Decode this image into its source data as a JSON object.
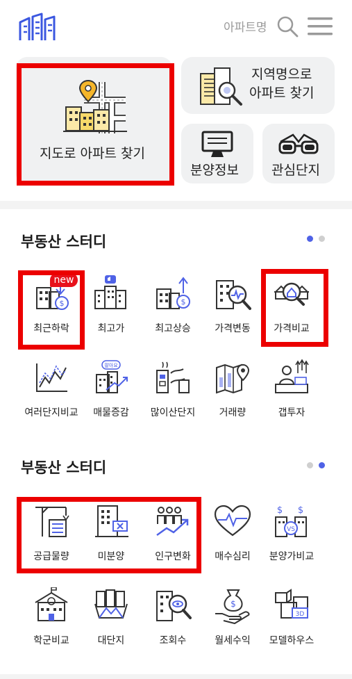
{
  "header": {
    "search_label": "아파트명",
    "logo": "apartment-logo",
    "icons": [
      "search-icon",
      "hamburger-menu-icon"
    ]
  },
  "quick": {
    "map_label": "지도로 아파트 찾기",
    "region_label": "지역명으로\n아파트 찾기",
    "sale_label": "분양정보",
    "fav_label": "관심단지"
  },
  "section1": {
    "title": "부동산 스터디",
    "items": [
      {
        "label": "최근하락",
        "badge": "new",
        "icon": "price-drop-icon"
      },
      {
        "label": "최고가",
        "icon": "top-price-icon"
      },
      {
        "label": "최고상승",
        "icon": "top-rise-icon"
      },
      {
        "label": "가격변동",
        "icon": "price-change-icon"
      },
      {
        "label": "가격비교",
        "icon": "price-compare-icon"
      },
      {
        "label": "여러단지비교",
        "icon": "multi-compare-icon"
      },
      {
        "label": "매물증감",
        "icon": "listing-change-icon"
      },
      {
        "label": "많이산단지",
        "icon": "most-bought-icon"
      },
      {
        "label": "거래량",
        "icon": "trade-volume-icon"
      },
      {
        "label": "갭투자",
        "icon": "gap-invest-icon"
      }
    ]
  },
  "section2": {
    "title": "부동산 스터디",
    "items": [
      {
        "label": "공급물량",
        "icon": "supply-icon"
      },
      {
        "label": "미분양",
        "icon": "unsold-icon"
      },
      {
        "label": "인구변화",
        "icon": "population-icon"
      },
      {
        "label": "매수심리",
        "icon": "buyer-sentiment-icon"
      },
      {
        "label": "분양가비교",
        "icon": "sale-price-compare-icon"
      },
      {
        "label": "학군비교",
        "icon": "school-district-icon"
      },
      {
        "label": "대단지",
        "icon": "large-complex-icon"
      },
      {
        "label": "조회수",
        "icon": "view-count-icon"
      },
      {
        "label": "월세수익",
        "icon": "rent-income-icon"
      },
      {
        "label": "모델하우스",
        "icon": "model-house-icon"
      }
    ]
  },
  "colors": {
    "accent": "#4f62e6",
    "highlight": "#ec0000",
    "badge": "#e8111b",
    "card": "#f0f1f2"
  }
}
